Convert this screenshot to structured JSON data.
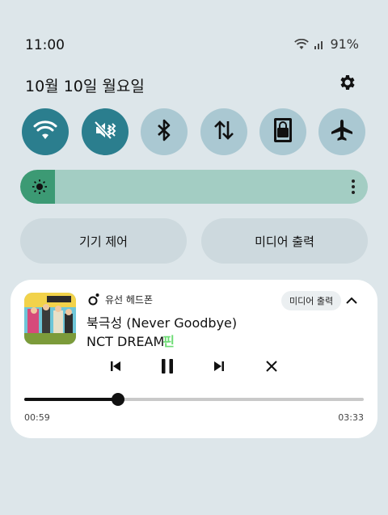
{
  "status_bar": {
    "time": "11:00",
    "battery": "91%",
    "icons": [
      "wifi-icon",
      "signal-icon"
    ]
  },
  "date": "10월 10일 월요일",
  "quick_settings": [
    {
      "name": "wifi",
      "icon": "wifi-icon",
      "state": "on"
    },
    {
      "name": "sound",
      "icon": "vibrate-icon",
      "state": "on"
    },
    {
      "name": "bluetooth",
      "icon": "bluetooth-icon",
      "state": "off"
    },
    {
      "name": "mobile-data",
      "icon": "data-arrows-icon",
      "state": "off"
    },
    {
      "name": "lock-rotation",
      "icon": "rotation-lock-icon",
      "state": "off"
    },
    {
      "name": "airplane",
      "icon": "airplane-icon",
      "state": "off"
    }
  ],
  "brightness": {
    "level": 0.1
  },
  "buttons": {
    "device_control": "기기 제어",
    "media_output": "미디어 출력"
  },
  "media": {
    "source": "유선 헤드폰",
    "output_chip": "미디어 출력",
    "title": "북극성 (Never Goodbye)",
    "artist": "NCT DREAM",
    "artist_glyph": "핀",
    "elapsed": "00:59",
    "total": "03:33",
    "progress": 0.277
  },
  "colors": {
    "accent_on": "#2b7e8e",
    "tile_off": "#aac8d2",
    "brightness_track": "#a3cdc3",
    "brightness_fill": "#3c9a74"
  }
}
